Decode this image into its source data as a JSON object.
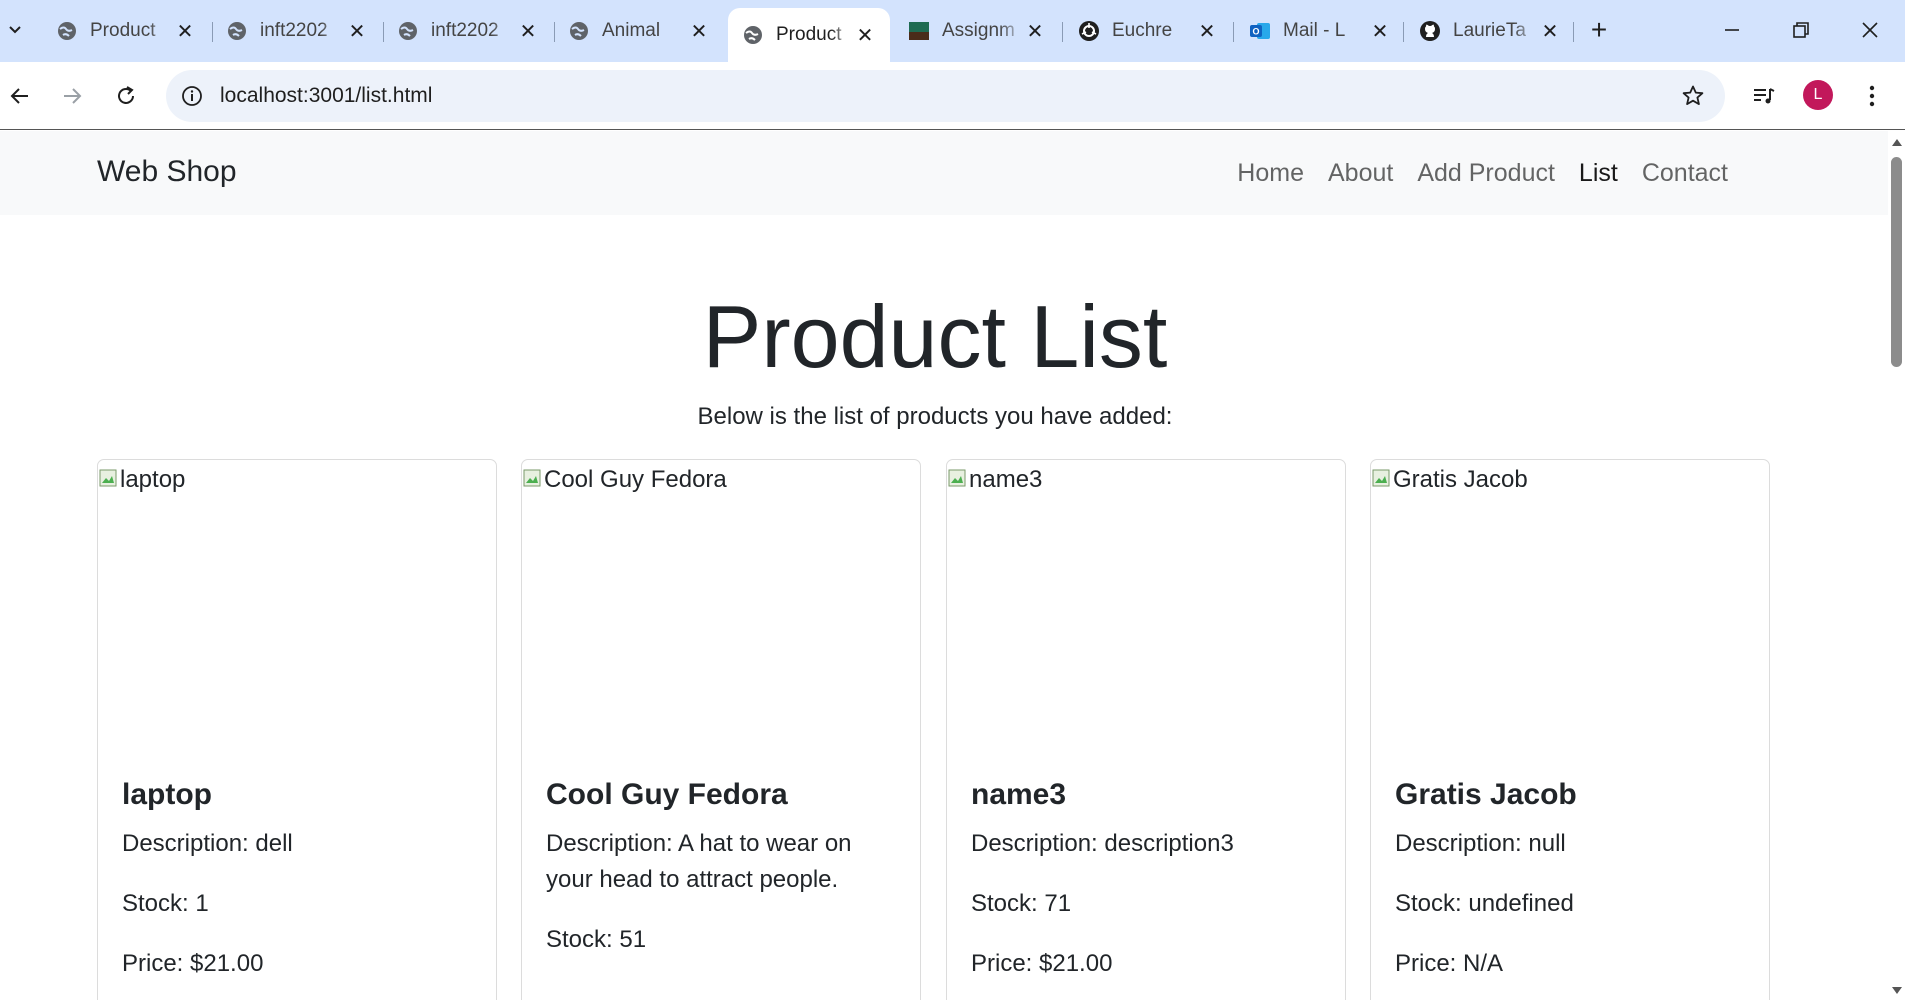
{
  "browser": {
    "tabs": [
      {
        "label": "Product",
        "icon": "globe-icon",
        "active": false
      },
      {
        "label": "inft2202",
        "icon": "globe-icon",
        "active": false
      },
      {
        "label": "inft2202",
        "icon": "globe-icon",
        "active": false
      },
      {
        "label": "Animal",
        "icon": "globe-icon",
        "active": false
      },
      {
        "label": "Product",
        "icon": "globe-icon",
        "active": true
      },
      {
        "label": "Assignm",
        "icon": "assignment-icon",
        "active": false
      },
      {
        "label": "Euchre",
        "icon": "openai-icon",
        "active": false
      },
      {
        "label": "Mail - L",
        "icon": "outlook-icon",
        "active": false
      },
      {
        "label": "LaurieTa",
        "icon": "github-icon",
        "active": false
      }
    ],
    "close_glyph": "✕",
    "new_tab_glyph": "+",
    "url": "localhost:3001/list.html",
    "profile_initial": "L"
  },
  "site": {
    "brand": "Web Shop",
    "nav": [
      {
        "label": "Home",
        "active": false
      },
      {
        "label": "About",
        "active": false
      },
      {
        "label": "Add Product",
        "active": false
      },
      {
        "label": "List",
        "active": true
      },
      {
        "label": "Contact",
        "active": false
      }
    ]
  },
  "page": {
    "title": "Product List",
    "subtitle": "Below is the list of products you have added:"
  },
  "products": [
    {
      "image_alt": "laptop",
      "name": "laptop",
      "description": "Description: dell",
      "stock": "Stock: 1",
      "price": "Price: $21.00"
    },
    {
      "image_alt": "Cool Guy Fedora",
      "name": "Cool Guy Fedora",
      "description": "Description: A hat to wear on your head to attract people.",
      "stock": "Stock: 51",
      "price": ""
    },
    {
      "image_alt": "name3",
      "name": "name3",
      "description": "Description: description3",
      "stock": "Stock: 71",
      "price": "Price: $21.00"
    },
    {
      "image_alt": "Gratis Jacob",
      "name": "Gratis Jacob",
      "description": "Description: null",
      "stock": "Stock: undefined",
      "price": "Price: N/A"
    }
  ]
}
